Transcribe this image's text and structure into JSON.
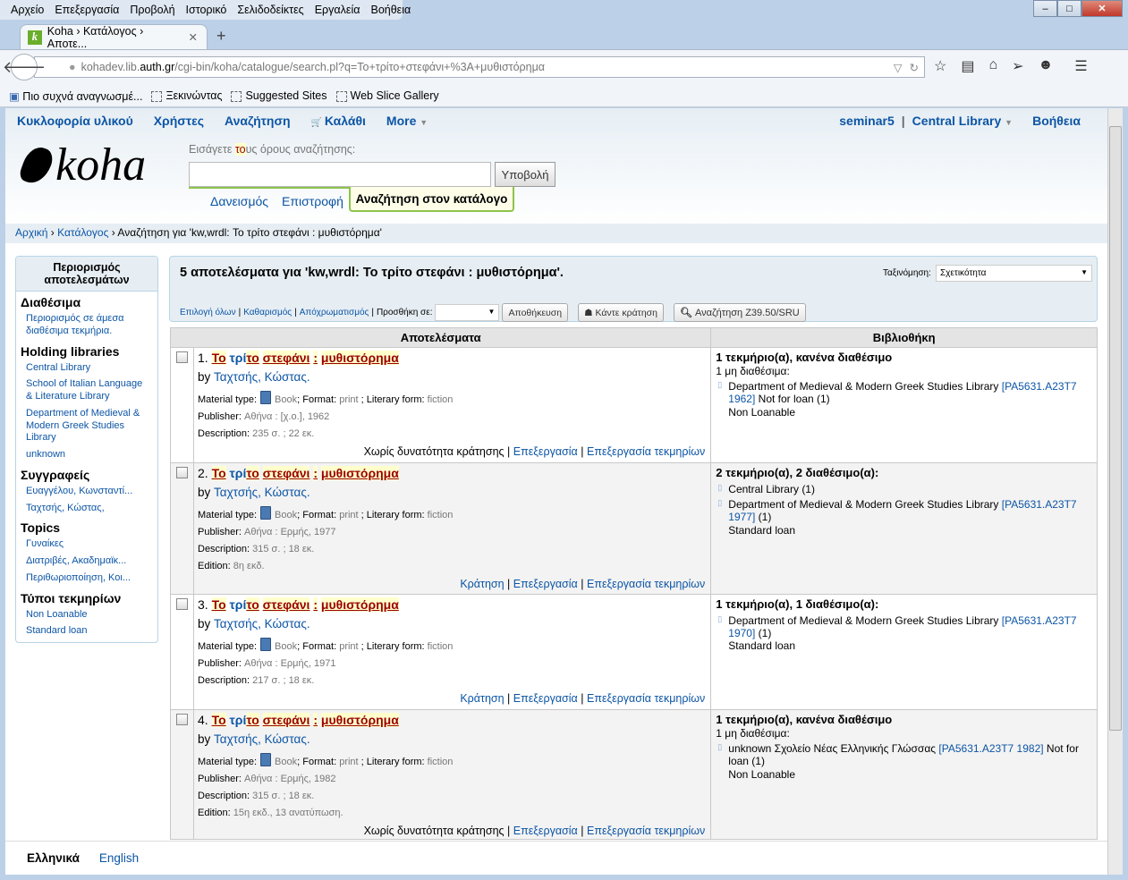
{
  "browser": {
    "menu": [
      "Αρχείο",
      "Επεξεργασία",
      "Προβολή",
      "Ιστορικό",
      "Σελιδοδείκτες",
      "Εργαλεία",
      "Βοήθεια"
    ],
    "tab_title": "Koha › Κατάλογος › Αποτε...",
    "url_pre": "kohadev.lib.",
    "url_domain": "auth.gr",
    "url_post": "/cgi-bin/koha/catalogue/search.pl?q=Το+τρίτο+στεφάνι+%3A+μυθιστόρημα",
    "bookmarks": [
      "Πιο συχνά αναγνωσμέ...",
      "Ξεκινώντας",
      "Suggested Sites",
      "Web Slice Gallery"
    ]
  },
  "topnav": {
    "items": [
      "Κυκλοφορία υλικού",
      "Χρήστες",
      "Αναζήτηση",
      "Καλάθι",
      "More"
    ],
    "user": "seminar5",
    "library": "Central Library",
    "help": "Βοήθεια"
  },
  "search": {
    "label_pre": "Εισάγετε ",
    "label_hl": "το",
    "label_post": "υς όρους αναζήτησης:",
    "value": "",
    "submit": "Υποβολή",
    "tabs": [
      "Δανεισμός",
      "Επιστροφή",
      "Αναζήτηση στον κατάλογο"
    ]
  },
  "breadcrumb": {
    "home": "Αρχική",
    "catalog": "Κατάλογος",
    "current": "Αναζήτηση για 'kw,wrdl: Το τρίτο στεφάνι : μυθιστόρημα'"
  },
  "facets": {
    "title": "Περιορισμός αποτελεσμάτων",
    "sections": [
      {
        "name": "Διαθέσιμα",
        "items": [
          "Περιορισμός σε άμεσα διαθέσιμα τεκμήρια."
        ]
      },
      {
        "name": "Holding libraries",
        "items": [
          "Central Library",
          "School of Italian Language & Literature Library",
          "Department of Medieval & Modern Greek Studies Library",
          "unknown"
        ]
      },
      {
        "name": "Συγγραφείς",
        "items": [
          "Ευαγγέλου, Κωνσταντί...",
          "Ταχτσής, Κώστας,"
        ]
      },
      {
        "name": "Topics",
        "items": [
          "Γυναίκες",
          "Διατριβές, Ακαδημαϊκ...",
          "Περιθωριοποίηση, Κοι..."
        ]
      },
      {
        "name": "Τύποι τεκμηρίων",
        "items": [
          "Non Loanable",
          "Standard loan"
        ]
      }
    ]
  },
  "results_bar": {
    "title": "5 αποτελέσματα για 'kw,wrdl: Το τρίτο στεφάνι : μυθιστόρημα'.",
    "sort_label": "Ταξινόμηση:",
    "sort_value": "Σχετικότητα",
    "select_all": "Επιλογή όλων",
    "clear": "Καθαρισμός",
    "unhighlight": "Απόχρωματισμός",
    "add_to": "Προσθήκη σε:",
    "save": "Αποθήκευση",
    "hold": "Κάντε κράτηση",
    "z3950": "Αναζήτηση Z39.50/SRU"
  },
  "table": {
    "col_results": "Αποτελέσματα",
    "col_library": "Βιβλιοθήκη"
  },
  "labels": {
    "by": "by",
    "material": "Material type:",
    "format": "Format:",
    "literary": "Literary form:",
    "publisher": "Publisher:",
    "description": "Description:",
    "edition": "Edition:",
    "edit": "Επεξεργασία",
    "edit_items": "Επεξεργασία τεκμηρίων"
  },
  "title_parts": [
    {
      "t": "Το",
      "hl": true
    },
    {
      "t": " τρί",
      "hl": false
    },
    {
      "t": "το",
      "hl": true
    },
    {
      "t": " ",
      "hl": false
    },
    {
      "t": "στεφάνι",
      "hl": true
    },
    {
      "t": " ",
      "hl": false
    },
    {
      "t": ":",
      "hl": true
    },
    {
      "t": " ",
      "hl": false
    },
    {
      "t": "μυθιστόρημα",
      "hl": true
    }
  ],
  "results": [
    {
      "num": "1.",
      "author": "Ταχτσής, Κώστας.",
      "material": "Book",
      "format": "print",
      "literary": "fiction",
      "publisher": "Αθήνα : [χ.ο.], 1962",
      "description": "235 σ. ; 22 εκ.",
      "edition": null,
      "hold": "Χωρίς δυνατότητα κράτησης",
      "lib": {
        "head": "1 τεκμήριο(α), κανένα διαθέσιμο",
        "sub": "1 μη διαθέσιμα:",
        "items": [
          {
            "pre": "Department of Medieval & Modern Greek Studies Library ",
            "call": "[PA5631.A23T7 1962]",
            "post": " Not for loan (1)",
            "type": "Non Loanable"
          }
        ]
      }
    },
    {
      "num": "2.",
      "author": "Ταχτσής, Κώστας.",
      "material": "Book",
      "format": "print",
      "literary": "fiction",
      "publisher": "Αθήνα : Ερμής, 1977",
      "description": "315 σ. ; 18 εκ.",
      "edition": "8η εκδ.",
      "hold": "Κράτηση",
      "lib": {
        "head": "2 τεκμήριο(α), 2 διαθέσιμο(α):",
        "sub": null,
        "items": [
          {
            "pre": "Central Library (1)",
            "call": null,
            "post": null,
            "type": null
          },
          {
            "pre": "Department of Medieval & Modern Greek Studies Library ",
            "call": "[PA5631.A23T7 1977]",
            "post": " (1)",
            "type": "Standard loan"
          }
        ]
      }
    },
    {
      "num": "3.",
      "author": "Ταχτσής, Κώστας.",
      "material": "Book",
      "format": "print",
      "literary": "fiction",
      "publisher": "Αθήνα : Ερμής, 1971",
      "description": "217 σ. ; 18 εκ.",
      "edition": null,
      "hold": "Κράτηση",
      "lib": {
        "head": "1 τεκμήριο(α), 1 διαθέσιμο(α):",
        "sub": null,
        "items": [
          {
            "pre": "Department of Medieval & Modern Greek Studies Library ",
            "call": "[PA5631.A23T7 1970]",
            "post": " (1)",
            "type": "Standard loan"
          }
        ]
      }
    },
    {
      "num": "4.",
      "author": "Ταχτσής, Κώστας.",
      "material": "Book",
      "format": "print",
      "literary": "fiction",
      "publisher": "Αθήνα : Ερμής, 1982",
      "description": "315 σ. ; 18 εκ.",
      "edition": "15η εκδ., 13 ανατύπωση.",
      "hold": "Χωρίς δυνατότητα κράτησης",
      "lib": {
        "head": "1 τεκμήριο(α), κανένα διαθέσιμο",
        "sub": "1 μη διαθέσιμα:",
        "items": [
          {
            "pre": "unknown Σχολείο Νέας Ελληνικής Γλώσσας ",
            "call": "[PA5631.A23T7 1982]",
            "post": " Not for loan (1)",
            "type": "Non Loanable"
          }
        ]
      }
    }
  ],
  "languages": [
    "Ελληνικά",
    "English"
  ]
}
